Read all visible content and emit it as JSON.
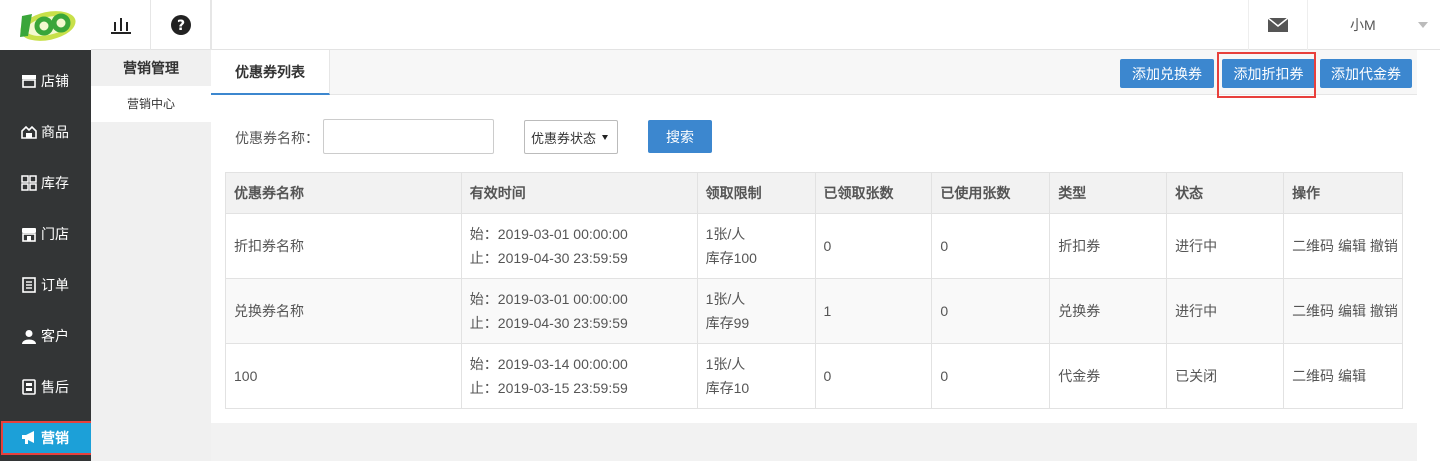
{
  "topbar": {
    "logo_icon": "brand-logo",
    "chart_icon": "bar-chart-icon",
    "help_icon": "question-circle-icon",
    "mail_icon": "envelope-icon",
    "user_name": "小M"
  },
  "sidebar": {
    "items": [
      {
        "label": "店铺",
        "icon": "store-icon"
      },
      {
        "label": "商品",
        "icon": "goods-icon"
      },
      {
        "label": "库存",
        "icon": "grid-icon"
      },
      {
        "label": "门店",
        "icon": "shop-icon"
      },
      {
        "label": "订单",
        "icon": "order-icon"
      },
      {
        "label": "客户",
        "icon": "user-icon"
      },
      {
        "label": "售后",
        "icon": "aftersale-icon"
      },
      {
        "label": "营销",
        "icon": "megaphone-icon"
      }
    ],
    "active_index": 7
  },
  "subsidebar": {
    "title": "营销管理",
    "items": [
      {
        "label": "营销中心"
      }
    ]
  },
  "tabs": [
    {
      "label": "优惠券列表"
    }
  ],
  "actions": {
    "add_exchange": "添加兑换券",
    "add_discount": "添加折扣券",
    "add_voucher": "添加代金券"
  },
  "search": {
    "name_label": "优惠券名称：",
    "name_value": "",
    "status_label": "优惠券状态",
    "search_button": "搜索"
  },
  "table": {
    "headers": [
      "优惠券名称",
      "有效时间",
      "领取限制",
      "已领取张数",
      "已使用张数",
      "类型",
      "状态",
      "操作"
    ],
    "rows": [
      {
        "name": "折扣券名称",
        "start": "始：2019-03-01 00:00:00",
        "end": "止：2019-04-30 23:59:59",
        "limit": "1张/人",
        "stock": "库存100",
        "received": "0",
        "used": "0",
        "type": "折扣券",
        "status": "进行中",
        "ops": [
          "二维码",
          "编辑",
          "撤销"
        ]
      },
      {
        "name": "兑换券名称",
        "start": "始：2019-03-01 00:00:00",
        "end": "止：2019-04-30 23:59:59",
        "limit": "1张/人",
        "stock": "库存99",
        "received": "1",
        "used": "0",
        "type": "兑换券",
        "status": "进行中",
        "ops": [
          "二维码",
          "编辑",
          "撤销"
        ]
      },
      {
        "name": "100",
        "start": "始：2019-03-14 00:00:00",
        "end": "止：2019-03-15 23:59:59",
        "limit": "1张/人",
        "stock": "库存10",
        "received": "0",
        "used": "0",
        "type": "代金券",
        "status": "已关闭",
        "ops": [
          "二维码",
          "编辑"
        ]
      }
    ]
  },
  "colors": {
    "sidebar_bg": "#333536",
    "active_item": "#1ca0d8",
    "primary_button": "#3c87cf",
    "highlight_box": "#e8403c"
  }
}
